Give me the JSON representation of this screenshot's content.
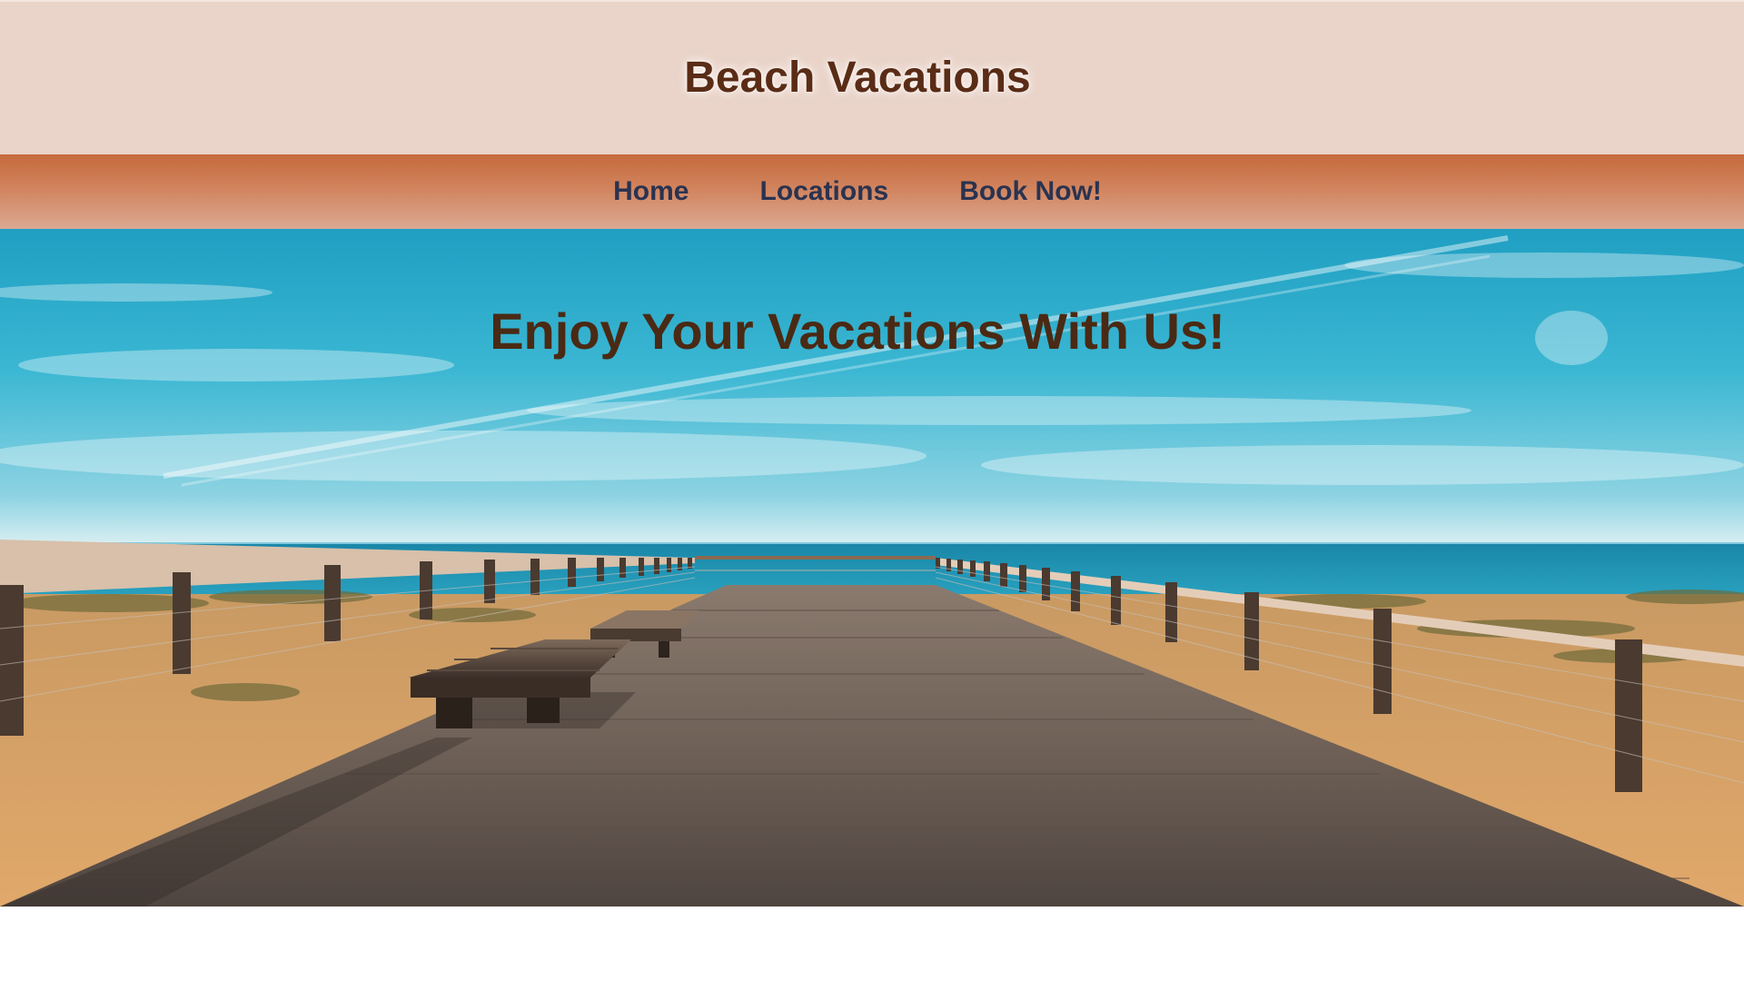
{
  "header": {
    "title": "Beach Vacations"
  },
  "nav": {
    "items": [
      {
        "label": "Home"
      },
      {
        "label": "Locations"
      },
      {
        "label": "Book Now!"
      }
    ]
  },
  "hero": {
    "heading": "Enjoy Your Vacations With Us!",
    "image": "beach-boardwalk-with-benches"
  },
  "colors": {
    "header_bg": "#ead4c9",
    "title_text": "#5a2c16",
    "nav_bg": "#c56a3d",
    "nav_text": "#2a3350",
    "hero_heading_text": "#4a2a14",
    "sky": "#3eb6d3",
    "sea": "#1c94b6",
    "sand": "#dca46b",
    "deck": "#6f6259"
  }
}
